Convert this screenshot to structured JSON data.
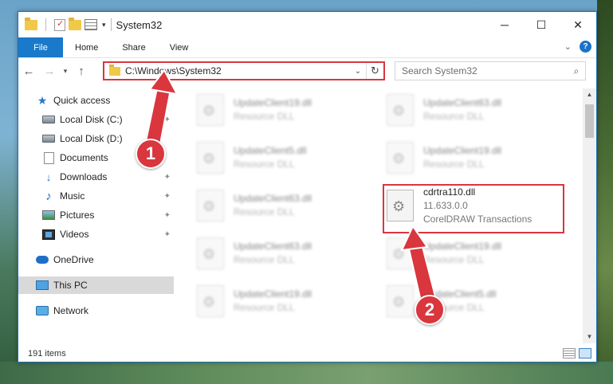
{
  "window": {
    "title": "System32",
    "controls": {
      "minimize": "─",
      "maximize": "☐",
      "close": "✕"
    }
  },
  "ribbon": {
    "tabs": [
      "File",
      "Home",
      "Share",
      "View"
    ],
    "help": "?"
  },
  "address": {
    "path": "C:\\Windows\\System32"
  },
  "search": {
    "placeholder": "Search System32"
  },
  "sidebar": {
    "items": [
      {
        "label": "Quick access",
        "icon": "star-icon"
      },
      {
        "label": "Local Disk (C:)",
        "icon": "disk-icon"
      },
      {
        "label": "Local Disk (D:)",
        "icon": "disk-icon"
      },
      {
        "label": "Documents",
        "icon": "documents-icon"
      },
      {
        "label": "Downloads",
        "icon": "downloads-icon"
      },
      {
        "label": "Music",
        "icon": "music-icon"
      },
      {
        "label": "Pictures",
        "icon": "pictures-icon"
      },
      {
        "label": "Videos",
        "icon": "videos-icon"
      },
      {
        "label": "OneDrive",
        "icon": "onedrive-icon"
      },
      {
        "label": "This PC",
        "icon": "pc-icon"
      },
      {
        "label": "Network",
        "icon": "network-icon"
      }
    ]
  },
  "files": {
    "left": [
      {
        "name": "UpdateClient19.dll",
        "type": "Resource DLL"
      },
      {
        "name": "UpdateClient5.dll",
        "type": "Resource DLL"
      },
      {
        "name": "UpdateClient63.dll",
        "type": "Resource DLL"
      },
      {
        "name": "UpdateClient63.dll",
        "type": "Resource DLL"
      },
      {
        "name": "UpdateClient19.dll",
        "type": "Resource DLL"
      }
    ],
    "right": [
      {
        "name": "UpdateClient63.dll",
        "type": "Resource DLL"
      },
      {
        "name": "UpdateClient19.dll",
        "type": "Resource DLL"
      },
      {
        "name": "UpdateClient19.dll",
        "type": "Resource DLL"
      },
      {
        "name": "UpdateClient5.dll",
        "type": "Resource DLL"
      }
    ],
    "highlighted": {
      "name": "cdrtra110.dll",
      "version": "11.633.0.0",
      "description": "CorelDRAW Transactions"
    }
  },
  "status": {
    "item_count": "191 items"
  },
  "annotations": {
    "step1": "1",
    "step2": "2",
    "color": "#d9363e"
  }
}
